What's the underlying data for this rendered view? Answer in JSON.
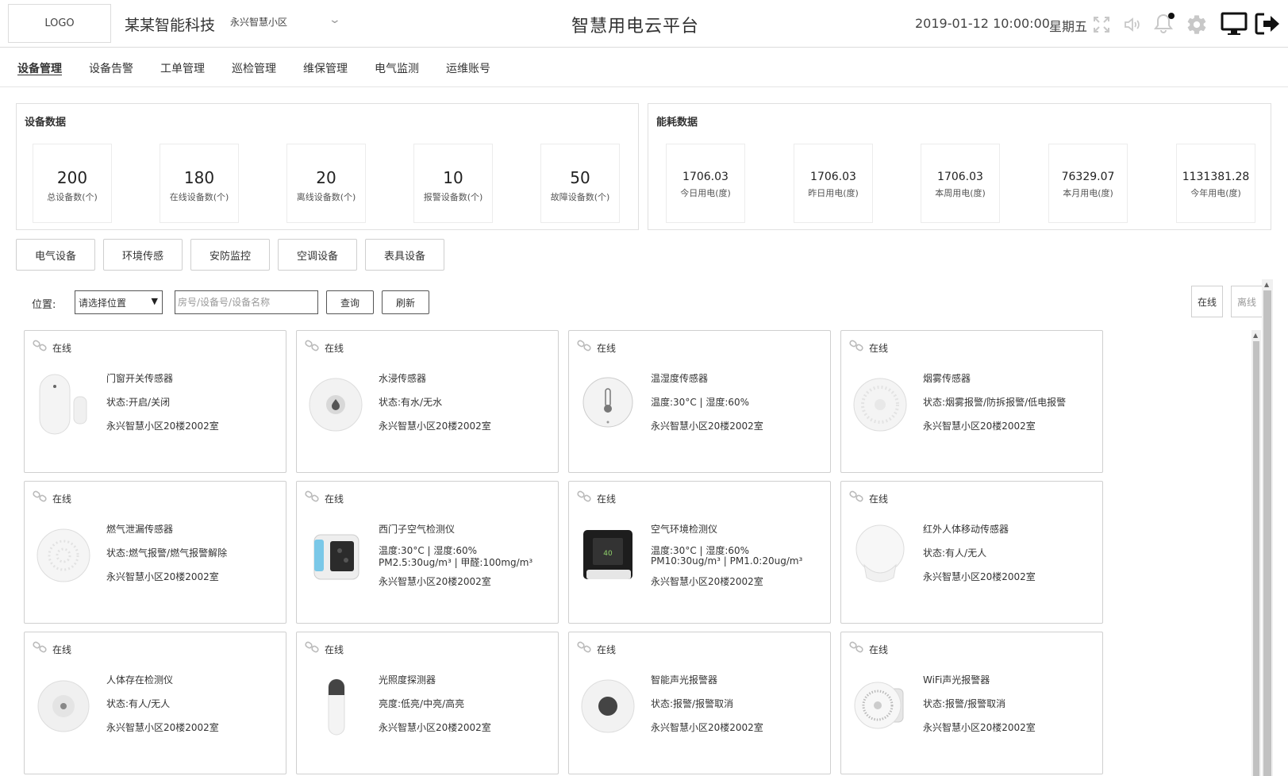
{
  "header": {
    "logo": "LOGO",
    "company": "某某智能科技",
    "community": "永兴智慧小区",
    "title": "智慧用电云平台",
    "datetime": "2019-01-12 10:00:00",
    "weekday": "星期五"
  },
  "nav": [
    "设备管理",
    "设备告警",
    "工单管理",
    "巡检管理",
    "维保管理",
    "电气监测",
    "运维账号"
  ],
  "device_stats": {
    "title": "设备数据",
    "items": [
      {
        "value": "200",
        "label": "总设备数(个)"
      },
      {
        "value": "180",
        "label": "在线设备数(个)"
      },
      {
        "value": "20",
        "label": "离线设备数(个)"
      },
      {
        "value": "10",
        "label": "报警设备数(个)"
      },
      {
        "value": "50",
        "label": "故障设备数(个)"
      }
    ]
  },
  "energy_stats": {
    "title": "能耗数据",
    "items": [
      {
        "value": "1706.03",
        "label": "今日用电(度)"
      },
      {
        "value": "1706.03",
        "label": "昨日用电(度)"
      },
      {
        "value": "1706.03",
        "label": "本周用电(度)"
      },
      {
        "value": "76329.07",
        "label": "本月用电(度)"
      },
      {
        "value": "1131381.28",
        "label": "今年用电(度)"
      }
    ]
  },
  "categories": [
    "电气设备",
    "环境传感",
    "安防监控",
    "空调设备",
    "表具设备"
  ],
  "filter": {
    "location_label": "位置:",
    "location_select": "请选择位置",
    "search_placeholder": "房号/设备号/设备名称",
    "query_button": "查询",
    "refresh_button": "刷新",
    "online_tab": "在线",
    "offline_tab": "离线"
  },
  "devices": [
    {
      "status": "在线",
      "name": "门窗开关传感器",
      "state": "状态:开启/关闭",
      "state2": "",
      "location": "永兴智慧小区20楼2002室",
      "icon": "door-sensor-icon"
    },
    {
      "status": "在线",
      "name": "水浸传感器",
      "state": "状态:有水/无水",
      "state2": "",
      "location": "永兴智慧小区20楼2002室",
      "icon": "water-leak-sensor-icon"
    },
    {
      "status": "在线",
      "name": "温湿度传感器",
      "state": "温度:30°C | 湿度:60%",
      "state2": "",
      "location": "永兴智慧小区20楼2002室",
      "icon": "thermometer-sensor-icon"
    },
    {
      "status": "在线",
      "name": "烟雾传感器",
      "state": "状态:烟雾报警/防拆报警/低电报警",
      "state2": "",
      "location": "永兴智慧小区20楼2002室",
      "icon": "smoke-detector-icon"
    },
    {
      "status": "在线",
      "name": "燃气泄漏传感器",
      "state": "状态:燃气报警/燃气报警解除",
      "state2": "",
      "location": "永兴智慧小区20楼2002室",
      "icon": "gas-leak-sensor-icon"
    },
    {
      "status": "在线",
      "name": "西门子空气检测仪",
      "state": "温度:30°C | 湿度:60%",
      "state2": "PM2.5:30ug/m³ | 甲醛:100mg/m³",
      "location": "永兴智慧小区20楼2002室",
      "icon": "air-monitor-icon"
    },
    {
      "status": "在线",
      "name": "空气环境检测仪",
      "state": "温度:30°C | 湿度:60%",
      "state2": "PM10:30ug/m³ | PM1.0:20ug/m³",
      "location": "永兴智慧小区20楼2002室",
      "icon": "air-environment-monitor-icon"
    },
    {
      "status": "在线",
      "name": "红外人体移动传感器",
      "state": "状态:有人/无人",
      "state2": "",
      "location": "永兴智慧小区20楼2002室",
      "icon": "motion-sensor-icon"
    },
    {
      "status": "在线",
      "name": "人体存在检测仪",
      "state": "状态:有人/无人",
      "state2": "",
      "location": "永兴智慧小区20楼2002室",
      "icon": "presence-detector-icon"
    },
    {
      "status": "在线",
      "name": "光照度探测器",
      "state": "亮度:低亮/中亮/高亮",
      "state2": "",
      "location": "永兴智慧小区20楼2002室",
      "icon": "light-sensor-icon"
    },
    {
      "status": "在线",
      "name": "智能声光报警器",
      "state": "状态:报警/报警取消",
      "state2": "",
      "location": "永兴智慧小区20楼2002室",
      "icon": "siren-alarm-icon"
    },
    {
      "status": "在线",
      "name": "WiFi声光报警器",
      "state": "状态:报警/报警取消",
      "state2": "",
      "location": "永兴智慧小区20楼2002室",
      "icon": "wifi-alarm-icon"
    }
  ]
}
